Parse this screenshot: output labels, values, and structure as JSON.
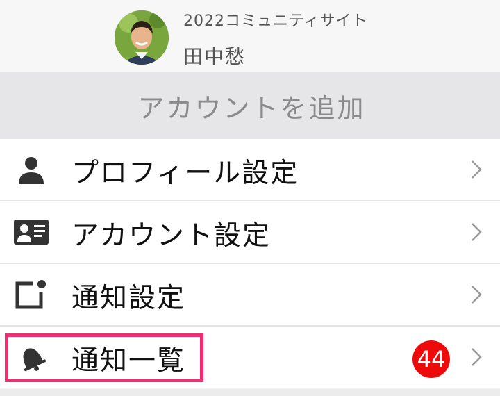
{
  "header": {
    "site_name": "2022コミュニティサイト",
    "user_name": "田中愁",
    "avatar_icon": "user-avatar-photo"
  },
  "add_account": {
    "label": "アカウントを追加"
  },
  "menu": {
    "items": [
      {
        "label": "プロフィール設定",
        "icon": "person-icon"
      },
      {
        "label": "アカウント設定",
        "icon": "id-card-icon"
      },
      {
        "label": "通知設定",
        "icon": "notification-settings-icon"
      },
      {
        "label": "通知一覧",
        "icon": "bell-icon",
        "badge": "44"
      }
    ]
  },
  "colors": {
    "badge": "#ee0a0a",
    "highlight_border": "#ee2f74",
    "text_primary": "#111111",
    "text_muted": "#8a8a8a"
  }
}
